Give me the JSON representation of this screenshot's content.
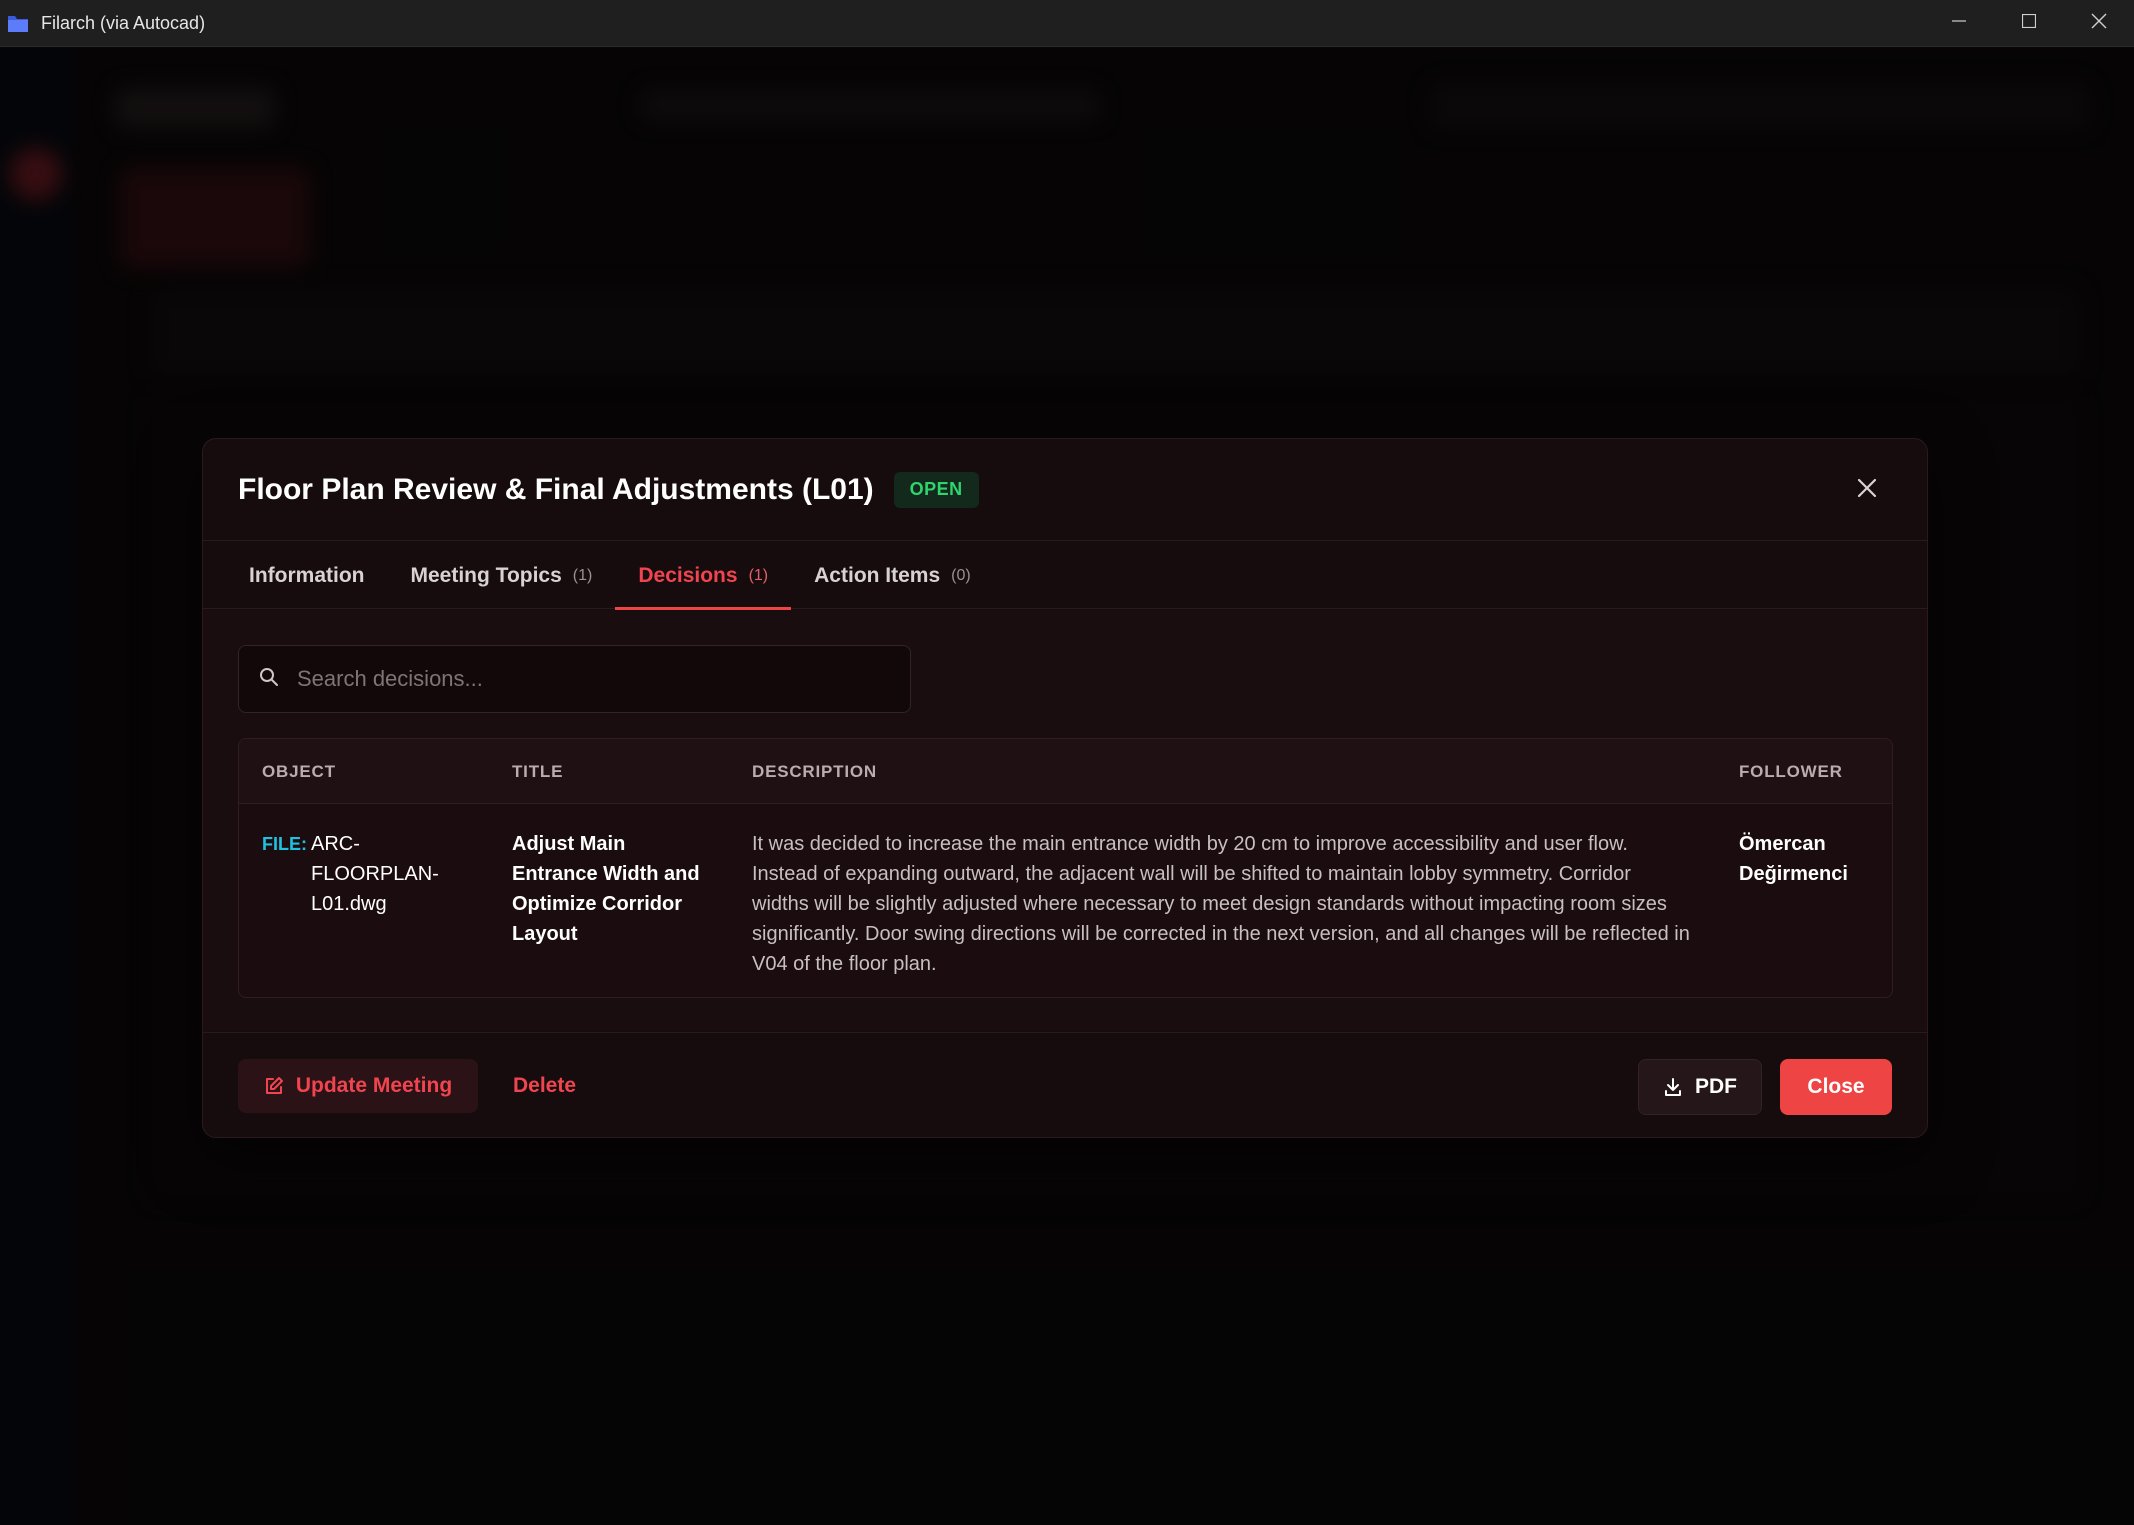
{
  "window": {
    "title": "Filarch (via Autocad)"
  },
  "modal": {
    "title": "Floor Plan Review & Final Adjustments (L01)",
    "status": "OPEN",
    "tabs": [
      {
        "label": "Information",
        "count": ""
      },
      {
        "label": "Meeting Topics",
        "count": "(1)"
      },
      {
        "label": "Decisions",
        "count": "(1)"
      },
      {
        "label": "Action Items",
        "count": "(0)"
      }
    ],
    "active_tab": "Decisions",
    "search": {
      "placeholder": "Search decisions...",
      "value": ""
    },
    "table": {
      "columns": [
        "OBJECT",
        "TITLE",
        "DESCRIPTION",
        "FOLLOWER"
      ],
      "rows": [
        {
          "object_prefix": "FILE:",
          "object_name": "ARC-FLOORPLAN-L01.dwg",
          "title": "Adjust Main Entrance Width and Optimize Corridor Layout",
          "description": "It was decided to increase the main entrance width by 20 cm to improve accessibility and user flow. Instead of expanding outward, the adjacent wall will be shifted to maintain lobby symmetry. Corridor widths will be slightly adjusted where necessary to meet design standards without impacting room sizes significantly. Door swing directions will be corrected in the next version, and all changes will be reflected in V04 of the floor plan.",
          "follower": "Ömercan Değirmenci"
        }
      ]
    },
    "footer": {
      "update_label": "Update Meeting",
      "delete_label": "Delete",
      "pdf_label": "PDF",
      "close_label": "Close"
    }
  },
  "colors": {
    "accent": "#ef4444",
    "status_open": "#30d46f",
    "file_prefix": "#1fc0e0",
    "modal_bg": "#160c0e"
  },
  "icons": {
    "app": "folder-app-icon",
    "minimize": "minimize-icon",
    "maximize": "maximize-icon",
    "window_close": "window-close-icon",
    "modal_close": "close-icon",
    "search": "search-icon",
    "update": "edit-icon",
    "pdf": "download-icon"
  }
}
